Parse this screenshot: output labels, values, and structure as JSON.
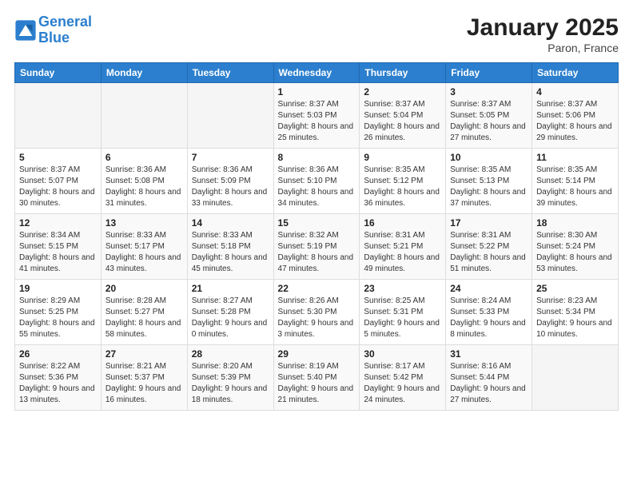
{
  "header": {
    "logo_line1": "General",
    "logo_line2": "Blue",
    "month_year": "January 2025",
    "location": "Paron, France"
  },
  "weekdays": [
    "Sunday",
    "Monday",
    "Tuesday",
    "Wednesday",
    "Thursday",
    "Friday",
    "Saturday"
  ],
  "weeks": [
    [
      {
        "day": "",
        "sunrise": "",
        "sunset": "",
        "daylight": ""
      },
      {
        "day": "",
        "sunrise": "",
        "sunset": "",
        "daylight": ""
      },
      {
        "day": "",
        "sunrise": "",
        "sunset": "",
        "daylight": ""
      },
      {
        "day": "1",
        "sunrise": "Sunrise: 8:37 AM",
        "sunset": "Sunset: 5:03 PM",
        "daylight": "Daylight: 8 hours and 25 minutes."
      },
      {
        "day": "2",
        "sunrise": "Sunrise: 8:37 AM",
        "sunset": "Sunset: 5:04 PM",
        "daylight": "Daylight: 8 hours and 26 minutes."
      },
      {
        "day": "3",
        "sunrise": "Sunrise: 8:37 AM",
        "sunset": "Sunset: 5:05 PM",
        "daylight": "Daylight: 8 hours and 27 minutes."
      },
      {
        "day": "4",
        "sunrise": "Sunrise: 8:37 AM",
        "sunset": "Sunset: 5:06 PM",
        "daylight": "Daylight: 8 hours and 29 minutes."
      }
    ],
    [
      {
        "day": "5",
        "sunrise": "Sunrise: 8:37 AM",
        "sunset": "Sunset: 5:07 PM",
        "daylight": "Daylight: 8 hours and 30 minutes."
      },
      {
        "day": "6",
        "sunrise": "Sunrise: 8:36 AM",
        "sunset": "Sunset: 5:08 PM",
        "daylight": "Daylight: 8 hours and 31 minutes."
      },
      {
        "day": "7",
        "sunrise": "Sunrise: 8:36 AM",
        "sunset": "Sunset: 5:09 PM",
        "daylight": "Daylight: 8 hours and 33 minutes."
      },
      {
        "day": "8",
        "sunrise": "Sunrise: 8:36 AM",
        "sunset": "Sunset: 5:10 PM",
        "daylight": "Daylight: 8 hours and 34 minutes."
      },
      {
        "day": "9",
        "sunrise": "Sunrise: 8:35 AM",
        "sunset": "Sunset: 5:12 PM",
        "daylight": "Daylight: 8 hours and 36 minutes."
      },
      {
        "day": "10",
        "sunrise": "Sunrise: 8:35 AM",
        "sunset": "Sunset: 5:13 PM",
        "daylight": "Daylight: 8 hours and 37 minutes."
      },
      {
        "day": "11",
        "sunrise": "Sunrise: 8:35 AM",
        "sunset": "Sunset: 5:14 PM",
        "daylight": "Daylight: 8 hours and 39 minutes."
      }
    ],
    [
      {
        "day": "12",
        "sunrise": "Sunrise: 8:34 AM",
        "sunset": "Sunset: 5:15 PM",
        "daylight": "Daylight: 8 hours and 41 minutes."
      },
      {
        "day": "13",
        "sunrise": "Sunrise: 8:33 AM",
        "sunset": "Sunset: 5:17 PM",
        "daylight": "Daylight: 8 hours and 43 minutes."
      },
      {
        "day": "14",
        "sunrise": "Sunrise: 8:33 AM",
        "sunset": "Sunset: 5:18 PM",
        "daylight": "Daylight: 8 hours and 45 minutes."
      },
      {
        "day": "15",
        "sunrise": "Sunrise: 8:32 AM",
        "sunset": "Sunset: 5:19 PM",
        "daylight": "Daylight: 8 hours and 47 minutes."
      },
      {
        "day": "16",
        "sunrise": "Sunrise: 8:31 AM",
        "sunset": "Sunset: 5:21 PM",
        "daylight": "Daylight: 8 hours and 49 minutes."
      },
      {
        "day": "17",
        "sunrise": "Sunrise: 8:31 AM",
        "sunset": "Sunset: 5:22 PM",
        "daylight": "Daylight: 8 hours and 51 minutes."
      },
      {
        "day": "18",
        "sunrise": "Sunrise: 8:30 AM",
        "sunset": "Sunset: 5:24 PM",
        "daylight": "Daylight: 8 hours and 53 minutes."
      }
    ],
    [
      {
        "day": "19",
        "sunrise": "Sunrise: 8:29 AM",
        "sunset": "Sunset: 5:25 PM",
        "daylight": "Daylight: 8 hours and 55 minutes."
      },
      {
        "day": "20",
        "sunrise": "Sunrise: 8:28 AM",
        "sunset": "Sunset: 5:27 PM",
        "daylight": "Daylight: 8 hours and 58 minutes."
      },
      {
        "day": "21",
        "sunrise": "Sunrise: 8:27 AM",
        "sunset": "Sunset: 5:28 PM",
        "daylight": "Daylight: 9 hours and 0 minutes."
      },
      {
        "day": "22",
        "sunrise": "Sunrise: 8:26 AM",
        "sunset": "Sunset: 5:30 PM",
        "daylight": "Daylight: 9 hours and 3 minutes."
      },
      {
        "day": "23",
        "sunrise": "Sunrise: 8:25 AM",
        "sunset": "Sunset: 5:31 PM",
        "daylight": "Daylight: 9 hours and 5 minutes."
      },
      {
        "day": "24",
        "sunrise": "Sunrise: 8:24 AM",
        "sunset": "Sunset: 5:33 PM",
        "daylight": "Daylight: 9 hours and 8 minutes."
      },
      {
        "day": "25",
        "sunrise": "Sunrise: 8:23 AM",
        "sunset": "Sunset: 5:34 PM",
        "daylight": "Daylight: 9 hours and 10 minutes."
      }
    ],
    [
      {
        "day": "26",
        "sunrise": "Sunrise: 8:22 AM",
        "sunset": "Sunset: 5:36 PM",
        "daylight": "Daylight: 9 hours and 13 minutes."
      },
      {
        "day": "27",
        "sunrise": "Sunrise: 8:21 AM",
        "sunset": "Sunset: 5:37 PM",
        "daylight": "Daylight: 9 hours and 16 minutes."
      },
      {
        "day": "28",
        "sunrise": "Sunrise: 8:20 AM",
        "sunset": "Sunset: 5:39 PM",
        "daylight": "Daylight: 9 hours and 18 minutes."
      },
      {
        "day": "29",
        "sunrise": "Sunrise: 8:19 AM",
        "sunset": "Sunset: 5:40 PM",
        "daylight": "Daylight: 9 hours and 21 minutes."
      },
      {
        "day": "30",
        "sunrise": "Sunrise: 8:17 AM",
        "sunset": "Sunset: 5:42 PM",
        "daylight": "Daylight: 9 hours and 24 minutes."
      },
      {
        "day": "31",
        "sunrise": "Sunrise: 8:16 AM",
        "sunset": "Sunset: 5:44 PM",
        "daylight": "Daylight: 9 hours and 27 minutes."
      },
      {
        "day": "",
        "sunrise": "",
        "sunset": "",
        "daylight": ""
      }
    ]
  ]
}
